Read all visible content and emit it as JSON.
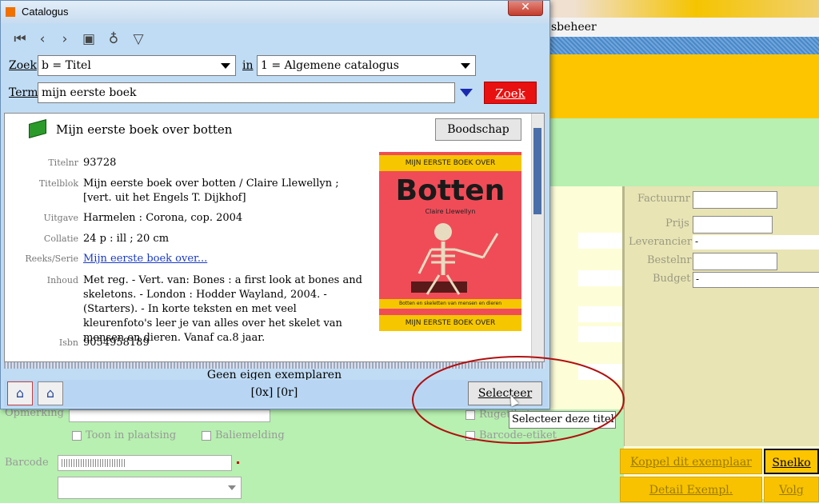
{
  "background": {
    "menu_text": "sbeheer",
    "panel": {
      "fields": [
        {
          "label": "Factuurnr",
          "value": ""
        },
        {
          "label": "Prijs",
          "value": ""
        },
        {
          "label": "Leverancier",
          "value": "-"
        },
        {
          "label": "Bestelnr",
          "value": ""
        },
        {
          "label": "Budget",
          "value": "-"
        }
      ]
    },
    "checkboxes": {
      "toon_in_plaatsing": "Toon in plaatsing",
      "baliemelding": "Baliemelding",
      "rugetiket": "Rugetiket",
      "barcode_etiket": "Barcode-etiket"
    },
    "opmerking_label": "Opmerking",
    "barcode_label": "Barcode",
    "buttons": {
      "koppel": "Koppel dit exemplaar",
      "snelk": "Snelko",
      "detail": "Detail Exempl.",
      "volg": "Volg"
    }
  },
  "dialog": {
    "title": "Catalogus",
    "close_glyph": "✕",
    "toolbar": {
      "icons": [
        "first-record-icon",
        "previous-icon",
        "next-icon",
        "briefcase-icon",
        "lightbulb-icon",
        "filter-icon"
      ]
    },
    "zoek_label": "Zoek",
    "zoek_value": "b = Titel",
    "in_label": "in",
    "in_value": "1 = Algemene catalogus",
    "term_label": "Term",
    "term_value": "mijn eerste boek",
    "zoek_button": "Zoek",
    "record": {
      "title": "Mijn eerste boek over botten",
      "boodschap_button": "Boodschap",
      "fields": [
        {
          "label": "Titelnr",
          "value": "93728"
        },
        {
          "label": "Titelblok",
          "value": "Mijn eerste boek over botten / Claire Llewellyn ; [vert. uit het Engels T. Dijkhof]"
        },
        {
          "label": "Uitgave",
          "value": "Harmelen : Corona, cop. 2004"
        },
        {
          "label": "Collatie",
          "value": "24 p : ill ; 20 cm"
        },
        {
          "label": "Reeks/Serie",
          "value": "Mijn eerste boek over..."
        },
        {
          "label": "Inhoud",
          "value": "Met reg. - Vert. van: Bones : a first look at bones and skeletons. - London : Hodder Wayland, 2004. - (Starters). - In korte teksten en met veel kleurenfoto's leer je van alles over het skelet van mensen en dieren. Vanaf ca.8 jaar."
        },
        {
          "label": "Isbn",
          "value": "9054958189"
        }
      ],
      "cover": {
        "top_band": "MIJN EERSTE BOEK OVER",
        "title": "Botten",
        "author": "Claire Llewellyn",
        "subtitle": "Botten en skeletten van mensen en dieren",
        "bottom_band": "MIJN EERSTE BOEK OVER"
      }
    },
    "status_text": "Geen eigen exemplaren",
    "counts": "[0x]  [0r]",
    "selecteer_button": "Selecteer",
    "tooltip": "Selecteer deze titel"
  }
}
